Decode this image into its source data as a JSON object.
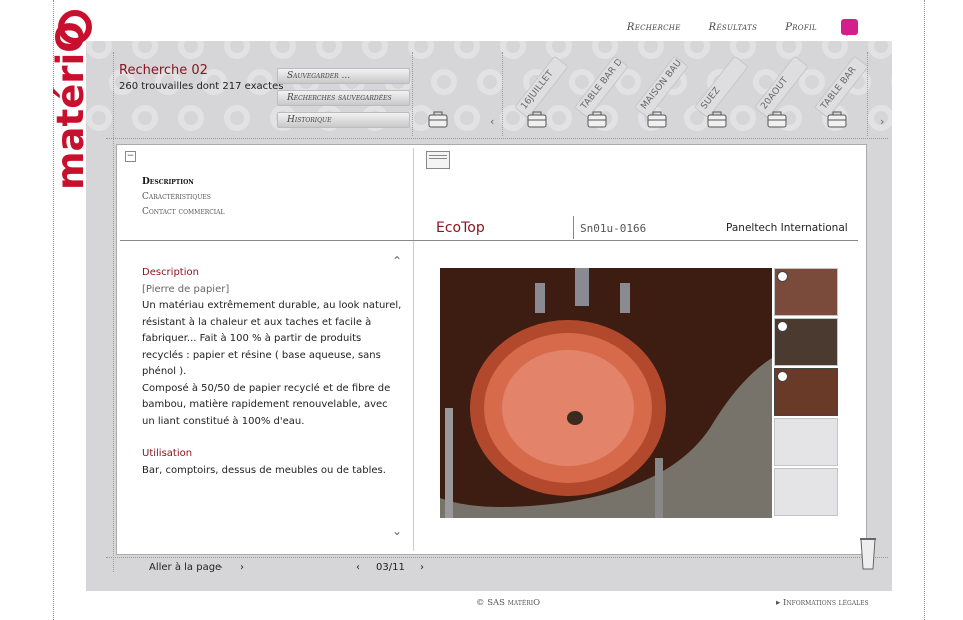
{
  "logo": {
    "text": "matériO"
  },
  "topnav": {
    "recherche": "Recherche",
    "resultats": "Résultats",
    "profil": "Profil"
  },
  "search": {
    "title": "Recherche 02",
    "count": "260 trouvailles dont 217 exactes",
    "save_label": "Sauvegarder ...",
    "saved_label": "Recherches sauvegardées",
    "history_label": "Historique"
  },
  "saved_tags": [
    "16JUILLET",
    "TABLE BAR DA",
    "MAISON BAU",
    "SUEZ",
    "20AOUT",
    "TABLE BAR"
  ],
  "tabs": [
    "Description",
    "Caractéristiques",
    "Contact commercial"
  ],
  "product": {
    "name": "EcoTop",
    "ref": "Sn01u-0166",
    "maker": "Paneltech International"
  },
  "description": {
    "heading": "Description",
    "subtitle": "[Pierre de papier]",
    "para1": "Un matériau extrêmement durable, au look naturel, résistant à la chaleur et aux taches et facile à fabriquer... Fait à 100 % à partir de produits recyclés : papier et résine ( base aqueuse, sans phénol ).",
    "para2": "Composé à 50/50 de papier recyclé et de fibre de bambou, matière rapidement renouvelable, avec un liant constitué à 100% d'eau.",
    "usage_heading": "Utilisation",
    "usage_text": "Bar, comptoirs, dessus de meubles ou de tables."
  },
  "pager": {
    "goto_label": "Aller à la page",
    "goto_value": "-",
    "current": "03/11"
  },
  "footer": {
    "copyright": "© SAS matériO",
    "legal": "▸ Informations légales"
  },
  "colors": {
    "accent": "#8a1620",
    "logo": "#c8102e",
    "chat": "#d31f8c",
    "panel_bg": "#d6d6d8"
  },
  "icons": [
    "logo-image",
    "chat-icon",
    "bag-icon",
    "arrow-left-icon",
    "arrow-right-icon",
    "collapse-icon",
    "card-icon",
    "chevron-up-icon",
    "chevron-down-icon",
    "zoom-icon",
    "trash-icon"
  ]
}
